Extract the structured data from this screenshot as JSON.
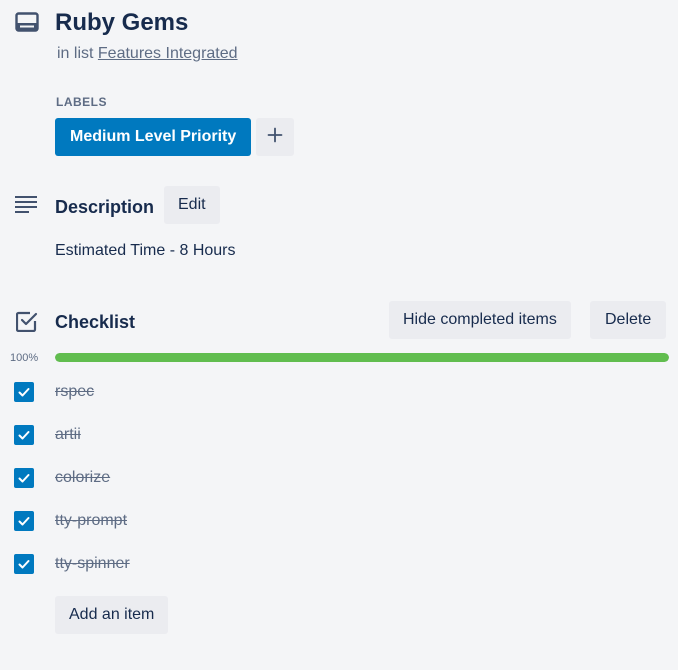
{
  "card": {
    "title": "Ruby Gems",
    "in_list_prefix": "in list",
    "list_name": "Features Integrated"
  },
  "labels": {
    "heading": "LABELS",
    "items": [
      {
        "text": "Medium Level Priority",
        "color": "#0079bf"
      }
    ],
    "add_icon": "plus-icon"
  },
  "description": {
    "title": "Description",
    "edit_label": "Edit",
    "text": "Estimated Time - 8 Hours"
  },
  "checklist": {
    "title": "Checklist",
    "hide_label": "Hide completed items",
    "delete_label": "Delete",
    "progress_percent": 100,
    "progress_text": "100%",
    "progress_color": "#61bd4f",
    "items": [
      {
        "text": "rspec",
        "checked": true
      },
      {
        "text": "artii",
        "checked": true
      },
      {
        "text": "colorize",
        "checked": true
      },
      {
        "text": "tty-prompt",
        "checked": true
      },
      {
        "text": "tty-spinner",
        "checked": true
      }
    ],
    "add_item_label": "Add an item"
  }
}
